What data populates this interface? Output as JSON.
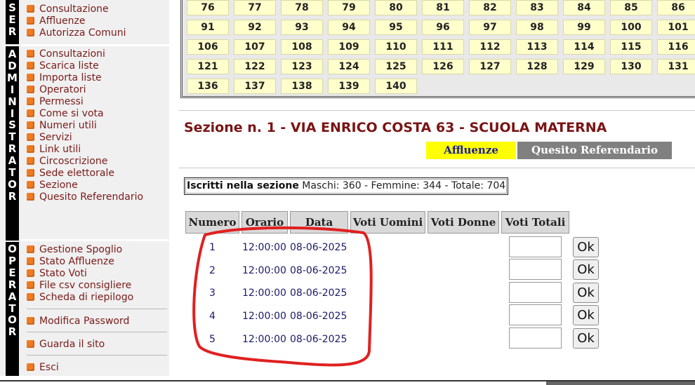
{
  "sidebar": {
    "ser_letters": [
      "S",
      "E",
      "R"
    ],
    "admin_letters": [
      "A",
      "D",
      "M",
      "I",
      "N",
      "I",
      "S",
      "T",
      "R",
      "A",
      "T",
      "O",
      "R"
    ],
    "oper_letters": [
      "O",
      "P",
      "E",
      "R",
      "A",
      "T",
      "O",
      "R"
    ],
    "ser_items": [
      "Consultazione",
      "Affluenze",
      "Autorizza Comuni"
    ],
    "admin_items": [
      "Consultazioni",
      "Scarica liste",
      "Importa liste",
      "Operatori",
      "Permessi",
      "Come si vota",
      "Numeri utili",
      "Servizi",
      "Link utili",
      "Circoscrizione",
      "Sede elettorale",
      "Sezione",
      "Quesito Referendario"
    ],
    "oper_items": [
      "Gestione Spoglio",
      "Stato Affluenze",
      "Stato Voti",
      "File csv consigliere",
      "Scheda di riepilogo"
    ],
    "modifica_password": "Modifica Password",
    "guarda_sito": "Guarda il sito",
    "esci": "Esci"
  },
  "sections_grid": [
    [
      "76",
      "77",
      "78",
      "79",
      "80",
      "81",
      "82",
      "83",
      "84",
      "85",
      "86"
    ],
    [
      "91",
      "92",
      "93",
      "94",
      "95",
      "96",
      "97",
      "98",
      "99",
      "100",
      "101"
    ],
    [
      "106",
      "107",
      "108",
      "109",
      "110",
      "111",
      "112",
      "113",
      "114",
      "115",
      "116"
    ],
    [
      "121",
      "122",
      "123",
      "124",
      "125",
      "126",
      "127",
      "128",
      "129",
      "130",
      "131"
    ],
    [
      "136",
      "137",
      "138",
      "139",
      "140"
    ]
  ],
  "section": {
    "title": "Sezione n. 1 - VIA ENRICO COSTA 63 - SCUOLA MATERNA",
    "tab_affluenze": "Affluenze",
    "tab_quesito": "Quesito Referendario",
    "iscritti_label": "Iscritti nella sezione",
    "iscritti_value": "Maschi: 360 - Femmine: 344 - Totale: 704"
  },
  "table": {
    "headers": [
      "Numero",
      "Orario",
      "Data",
      "Voti Uomini",
      "Voti Donne",
      "Voti Totali"
    ],
    "rows": [
      {
        "numero": "1",
        "orario": "12:00:00",
        "data": "08-06-2025",
        "ok": "Ok"
      },
      {
        "numero": "2",
        "orario": "12:00:00",
        "data": "08-06-2025",
        "ok": "Ok"
      },
      {
        "numero": "3",
        "orario": "12:00:00",
        "data": "08-06-2025",
        "ok": "Ok"
      },
      {
        "numero": "4",
        "orario": "12:00:00",
        "data": "08-06-2025",
        "ok": "Ok"
      },
      {
        "numero": "5",
        "orario": "12:00:00",
        "data": "08-06-2025",
        "ok": "Ok"
      }
    ]
  },
  "colors": {
    "menu_text": "#7a1a1a",
    "bullet": "#f07a22",
    "section_title": "#7a1414",
    "tab_active_bg": "#ffff00",
    "tab_inactive_bg": "#808080",
    "grid_cell_bg": "#ffffcc",
    "annotation": "#e02020"
  }
}
